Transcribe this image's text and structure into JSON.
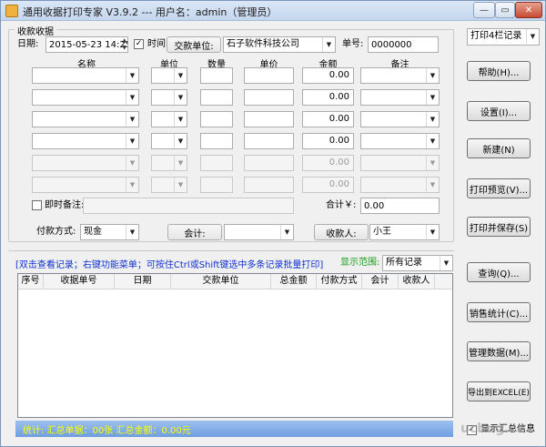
{
  "window": {
    "title": "通用收据打印专家 V3.9.2 --- 用户名：admin（管理员）",
    "min": "—",
    "max": "▭",
    "close": "✕"
  },
  "receipt": {
    "group_title": "收款收据",
    "date_label": "日期:",
    "date_value": "2015-05-23 14:25:",
    "time_label": "时间",
    "time_checked": true,
    "payer_label": "交款单位:",
    "payer_value": "石子软件科技公司",
    "number_label": "单号:",
    "number_value": "0000000",
    "columns": [
      "名称",
      "单位",
      "数量",
      "单价",
      "金额",
      "备注"
    ],
    "rows": [
      {
        "name": "",
        "unit": "",
        "qty": "",
        "price": "",
        "amount": "0.00",
        "note": "",
        "enabled": true
      },
      {
        "name": "",
        "unit": "",
        "qty": "",
        "price": "",
        "amount": "0.00",
        "note": "",
        "enabled": true
      },
      {
        "name": "",
        "unit": "",
        "qty": "",
        "price": "",
        "amount": "0.00",
        "note": "",
        "enabled": true
      },
      {
        "name": "",
        "unit": "",
        "qty": "",
        "price": "",
        "amount": "0.00",
        "note": "",
        "enabled": true
      },
      {
        "name": "",
        "unit": "",
        "qty": "",
        "price": "",
        "amount": "0.00",
        "note": "",
        "enabled": false
      },
      {
        "name": "",
        "unit": "",
        "qty": "",
        "price": "",
        "amount": "0.00",
        "note": "",
        "enabled": false
      }
    ],
    "instant_note_label": "即时备注:",
    "total_label": "合计￥:",
    "total_value": "0.00",
    "payment_label": "付款方式:",
    "payment_value": "现金",
    "accountant_label": "会计:",
    "accountant_value": "",
    "receiver_label": "收款人:",
    "receiver_value": "小王"
  },
  "side_buttons": {
    "print_columns": "打印4栏记录",
    "help": "帮助(H)...",
    "settings": "设置(I)...",
    "new": "新建(N)",
    "preview": "打印预览(V)...",
    "print_save": "打印并保存(S)",
    "query": "查询(Q)...",
    "sales_stats": "销售统计(C)...",
    "manage_data": "管理数据(M)...",
    "export_excel": "导出到EXCEL(E)",
    "show_summary": "显示汇总信息"
  },
  "records": {
    "hint": "[双击查看记录；右键功能菜单；可按住Ctrl或Shift键选中多条记录批量打印]",
    "range_label": "显示范围:",
    "range_value": "所有记录",
    "headers": [
      "序号",
      "收据单号",
      "日期",
      "交款单位",
      "总金额",
      "付款方式",
      "会计",
      "收款人"
    ]
  },
  "status": {
    "text": "统计:   汇总单据：00张     汇总金额：0.00元"
  },
  "watermark": "ucbug.cc",
  "colors": {
    "hint_blue": "#1030d0",
    "range_green": "#1a9a1a",
    "status_bg": "#7aa6e6",
    "status_text": "#ffff00"
  }
}
